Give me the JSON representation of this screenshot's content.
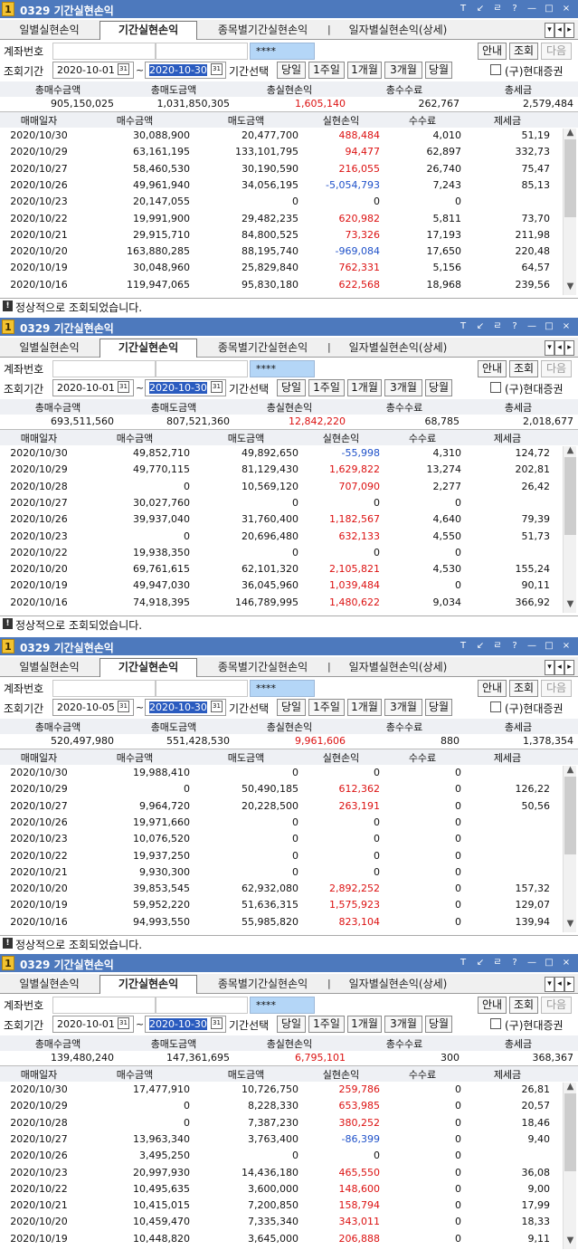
{
  "window": {
    "number": "1",
    "title": "0329 기간실현손익",
    "controls": [
      "T",
      "↙",
      "ㄹ",
      "?",
      "—",
      "□",
      "×"
    ]
  },
  "tabs": [
    "일별실현손익",
    "기간실현손익",
    "종목별기간실현손익",
    "일자별실현손익(상세)"
  ],
  "tab_separator": "|",
  "nav_buttons": [
    "▾",
    "◂",
    "▸"
  ],
  "labels": {
    "account": "계좌번호",
    "password_mask": "****",
    "info_button": "안내",
    "query_button": "조회",
    "next_button": "다음",
    "period_label": "조회기간",
    "tilde": "~",
    "period_select": "기간선택",
    "period_buttons": [
      "당일",
      "1주일",
      "1개월",
      "3개월",
      "당월"
    ],
    "broker_check": "(구)현대증권",
    "calendar_glyph": "31",
    "scroll_up": "▲",
    "scroll_down": "▼"
  },
  "summary_headers": [
    "총매수금액",
    "총매도금액",
    "총실현손익",
    "총수수료",
    "총세금"
  ],
  "detail_headers": [
    "매매일자",
    "매수금액",
    "매도금액",
    "실현손익",
    "수수료",
    "제세금"
  ],
  "status_icon": "!",
  "status_message": "정상적으로 조회되었습니다.",
  "panels": [
    {
      "start_date": "2020-10-01",
      "end_date": "2020-10-30",
      "summary": [
        "905,150,025",
        "1,031,850,305",
        "1,605,140",
        "262,767",
        "2,579,484"
      ],
      "rows": [
        [
          "2020/10/30",
          "30,088,900",
          "20,477,700",
          "488,484",
          "4,010",
          "51,19"
        ],
        [
          "2020/10/29",
          "63,161,195",
          "133,101,795",
          "94,477",
          "62,897",
          "332,73"
        ],
        [
          "2020/10/27",
          "58,460,530",
          "30,190,590",
          "216,055",
          "26,740",
          "75,47"
        ],
        [
          "2020/10/26",
          "49,961,940",
          "34,056,195",
          "-5,054,793",
          "7,243",
          "85,13"
        ],
        [
          "2020/10/23",
          "20,147,055",
          "0",
          "0",
          "0",
          ""
        ],
        [
          "2020/10/22",
          "19,991,900",
          "29,482,235",
          "620,982",
          "5,811",
          "73,70"
        ],
        [
          "2020/10/21",
          "29,915,710",
          "84,800,525",
          "73,326",
          "17,193",
          "211,98"
        ],
        [
          "2020/10/20",
          "163,880,285",
          "88,195,740",
          "-969,084",
          "17,650",
          "220,48"
        ],
        [
          "2020/10/19",
          "30,048,960",
          "25,829,840",
          "762,331",
          "5,156",
          "64,57"
        ],
        [
          "2020/10/16",
          "119,947,065",
          "95,830,180",
          "622,568",
          "18,968",
          "239,56"
        ]
      ]
    },
    {
      "start_date": "2020-10-01",
      "end_date": "2020-10-30",
      "summary": [
        "693,511,560",
        "807,521,360",
        "12,842,220",
        "68,785",
        "2,018,677"
      ],
      "rows": [
        [
          "2020/10/30",
          "49,852,710",
          "49,892,650",
          "-55,998",
          "4,310",
          "124,72"
        ],
        [
          "2020/10/29",
          "49,770,115",
          "81,129,430",
          "1,629,822",
          "13,274",
          "202,81"
        ],
        [
          "2020/10/28",
          "0",
          "10,569,120",
          "707,090",
          "2,277",
          "26,42"
        ],
        [
          "2020/10/27",
          "30,027,760",
          "0",
          "0",
          "0",
          ""
        ],
        [
          "2020/10/26",
          "39,937,040",
          "31,760,400",
          "1,182,567",
          "4,640",
          "79,39"
        ],
        [
          "2020/10/23",
          "0",
          "20,696,480",
          "632,133",
          "4,550",
          "51,73"
        ],
        [
          "2020/10/22",
          "19,938,350",
          "0",
          "0",
          "0",
          ""
        ],
        [
          "2020/10/20",
          "69,761,615",
          "62,101,320",
          "2,105,821",
          "4,530",
          "155,24"
        ],
        [
          "2020/10/19",
          "49,947,030",
          "36,045,960",
          "1,039,484",
          "0",
          "90,11"
        ],
        [
          "2020/10/16",
          "74,918,395",
          "146,789,995",
          "1,480,622",
          "9,034",
          "366,92"
        ]
      ]
    },
    {
      "start_date": "2020-10-05",
      "end_date": "2020-10-30",
      "summary": [
        "520,497,980",
        "551,428,530",
        "9,961,606",
        "880",
        "1,378,354"
      ],
      "rows": [
        [
          "2020/10/30",
          "19,988,410",
          "0",
          "0",
          "0",
          ""
        ],
        [
          "2020/10/29",
          "0",
          "50,490,185",
          "612,362",
          "0",
          "126,22"
        ],
        [
          "2020/10/27",
          "9,964,720",
          "20,228,500",
          "263,191",
          "0",
          "50,56"
        ],
        [
          "2020/10/26",
          "19,971,660",
          "0",
          "0",
          "0",
          ""
        ],
        [
          "2020/10/23",
          "10,076,520",
          "0",
          "0",
          "0",
          ""
        ],
        [
          "2020/10/22",
          "19,937,250",
          "0",
          "0",
          "0",
          ""
        ],
        [
          "2020/10/21",
          "9,930,300",
          "0",
          "0",
          "0",
          ""
        ],
        [
          "2020/10/20",
          "39,853,545",
          "62,932,080",
          "2,892,252",
          "0",
          "157,32"
        ],
        [
          "2020/10/19",
          "59,952,220",
          "51,636,315",
          "1,575,923",
          "0",
          "129,07"
        ],
        [
          "2020/10/16",
          "94,993,550",
          "55,985,820",
          "823,104",
          "0",
          "139,94"
        ]
      ]
    },
    {
      "start_date": "2020-10-01",
      "end_date": "2020-10-30",
      "summary": [
        "139,480,240",
        "147,361,695",
        "6,795,101",
        "300",
        "368,367"
      ],
      "rows": [
        [
          "2020/10/30",
          "17,477,910",
          "10,726,750",
          "259,786",
          "0",
          "26,81"
        ],
        [
          "2020/10/29",
          "0",
          "8,228,330",
          "653,985",
          "0",
          "20,57"
        ],
        [
          "2020/10/28",
          "0",
          "7,387,230",
          "380,252",
          "0",
          "18,46"
        ],
        [
          "2020/10/27",
          "13,963,340",
          "3,763,400",
          "-86,399",
          "0",
          "9,40"
        ],
        [
          "2020/10/26",
          "3,495,250",
          "0",
          "0",
          "0",
          ""
        ],
        [
          "2020/10/23",
          "20,997,930",
          "14,436,180",
          "465,550",
          "0",
          "36,08"
        ],
        [
          "2020/10/22",
          "10,495,635",
          "3,600,000",
          "148,600",
          "0",
          "9,00"
        ],
        [
          "2020/10/21",
          "10,415,015",
          "7,200,850",
          "158,794",
          "0",
          "17,99"
        ],
        [
          "2020/10/20",
          "10,459,470",
          "7,335,340",
          "343,011",
          "0",
          "18,33"
        ],
        [
          "2020/10/19",
          "10,448,820",
          "3,645,000",
          "206,888",
          "0",
          "9,11"
        ]
      ]
    }
  ],
  "colors": {
    "titlebar": "#4d79bd",
    "profit": "#dc1111",
    "loss": "#1f51c9",
    "date_highlight": "#2a5bbf",
    "password_field": "#b4d6f7"
  }
}
